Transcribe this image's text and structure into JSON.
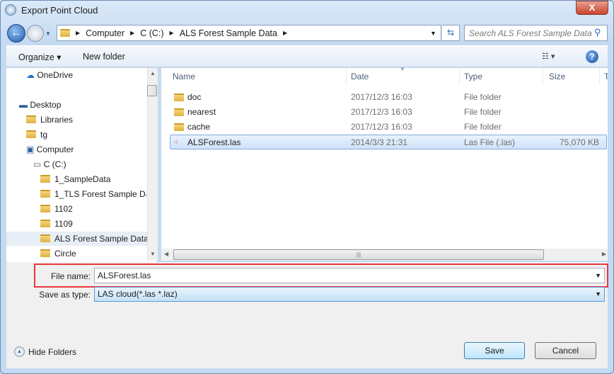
{
  "window": {
    "title": "Export Point Cloud",
    "close_label": "X"
  },
  "address": {
    "breadcrumbs": [
      "Computer",
      "C (C:)",
      "ALS Forest Sample Data"
    ],
    "search_placeholder": "Search ALS Forest Sample Data"
  },
  "toolbar": {
    "organize": "Organize ▾",
    "new_folder": "New folder",
    "views": "☷ ▾",
    "help": "?"
  },
  "nav": {
    "items": [
      {
        "label": "OneDrive",
        "icon": "cloud-icon"
      },
      {
        "label": "Desktop",
        "icon": "desktop-icon"
      },
      {
        "label": "Libraries",
        "icon": "libraries-icon"
      },
      {
        "label": "tg",
        "icon": "user-icon"
      },
      {
        "label": "Computer",
        "icon": "computer-icon"
      },
      {
        "label": "C (C:)",
        "icon": "drive-icon"
      },
      {
        "label": "1_SampleData",
        "icon": "folder-icon"
      },
      {
        "label": "1_TLS Forest Sample Dat",
        "icon": "folder-icon"
      },
      {
        "label": "1102",
        "icon": "folder-icon"
      },
      {
        "label": "1109",
        "icon": "folder-icon"
      },
      {
        "label": "ALS Forest Sample Data",
        "icon": "folder-icon",
        "selected": true
      },
      {
        "label": "Circle",
        "icon": "folder-icon"
      }
    ]
  },
  "list": {
    "columns": [
      "Name",
      "Date",
      "Type",
      "Size",
      "T"
    ],
    "rows": [
      {
        "name": "doc",
        "date": "2017/12/3 16:03",
        "type": "File folder",
        "size": ""
      },
      {
        "name": "nearest",
        "date": "2017/12/3 16:03",
        "type": "File folder",
        "size": ""
      },
      {
        "name": "cache",
        "date": "2017/12/3 16:03",
        "type": "File folder",
        "size": ""
      },
      {
        "name": "ALSForest.las",
        "date": "2014/3/3 21:31",
        "type": "Las File (.las)",
        "size": "75,070 KB",
        "selected": true
      }
    ]
  },
  "form": {
    "file_name_label": "File name:",
    "file_name_value": "ALSForest.las",
    "type_label": "Save as type:",
    "type_value": "LAS cloud(*.las *.laz)"
  },
  "buttons": {
    "hide_folders": "Hide Folders",
    "save": "Save",
    "cancel": "Cancel"
  },
  "colors": {
    "highlight_box": "#e8393c",
    "selection": "#cfe3fb"
  }
}
